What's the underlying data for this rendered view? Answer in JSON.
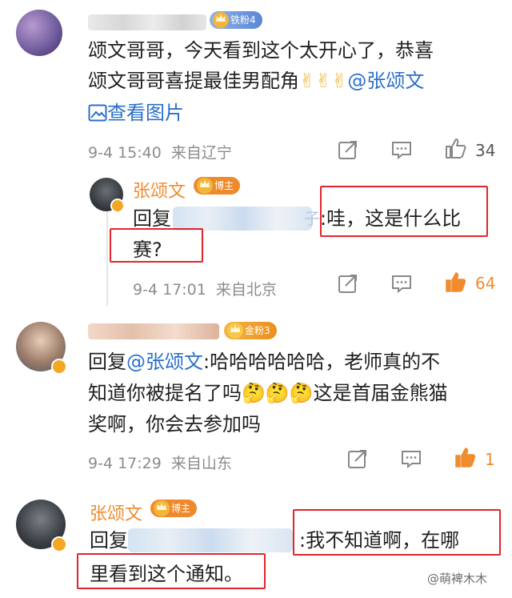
{
  "comments": [
    {
      "badge": "铁粉4",
      "text_line1": "颂文哥哥，今天看到这个太开心了，恭喜",
      "text_line2_pre": "颂文哥哥喜提最佳男配角",
      "emoji": "✌✌✌",
      "mention": "@张颂文",
      "view_image": "查看图片",
      "time": "9-4 15:40",
      "location": "来自辽宁",
      "likes": "34"
    },
    {
      "name": "张颂文",
      "badge": "博主",
      "reply_prefix": "回复",
      "reply_suffix": "子",
      "text_after": ":哇，这是什么比",
      "text_line2": "赛?",
      "time": "9-4 17:01",
      "location": "来自北京",
      "likes": "64"
    },
    {
      "badge": "金粉3",
      "reply_prefix": "回复",
      "mention": "@张颂文",
      "text_line1_after": ":哈哈哈哈哈哈，老师真的不",
      "text_line2_pre": "知道你被提名了吗",
      "emoji": "🤔🤔🤔",
      "text_line2_post": "这是首届金熊猫",
      "text_line3": "奖啊，你会去参加吗",
      "time": "9-4 17:29",
      "location": "来自山东",
      "likes": "1"
    },
    {
      "name": "张颂文",
      "badge": "博主",
      "reply_prefix": "回复",
      "text_after": ":我不知道啊，在哪",
      "text_line2": "里看到这个通知。"
    }
  ],
  "watermark": "@萌裨木木",
  "colors": {
    "accent_red": "#e0262d",
    "link_blue": "#2a6fc9",
    "like_orange": "#f08c2e",
    "meta_gray": "#8c8c8c"
  },
  "icons": [
    "share-icon",
    "comment-icon",
    "like-icon",
    "image-icon",
    "crown-icon",
    "verified-icon"
  ]
}
